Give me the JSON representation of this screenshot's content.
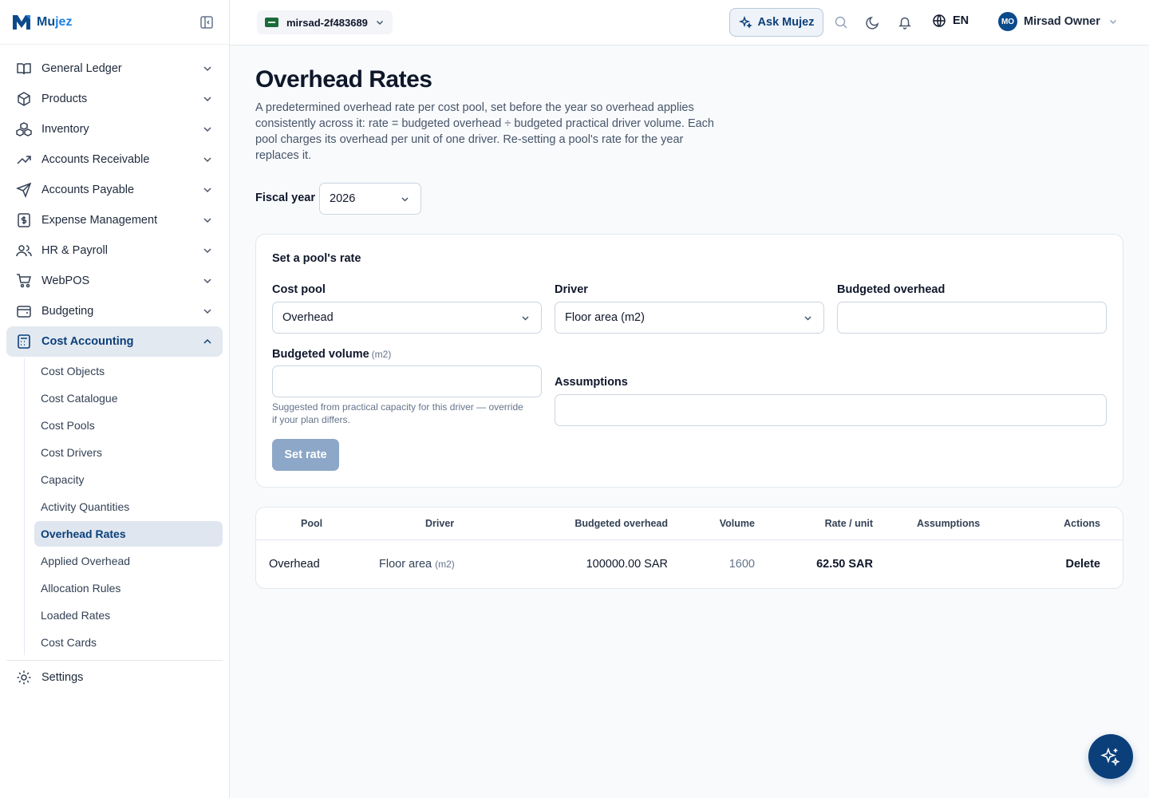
{
  "brand": {
    "name_prefix": "Mu",
    "name_suffix": "jez"
  },
  "org": {
    "name": "mirsad-2f483689"
  },
  "topbar": {
    "ask_label": "Ask Mujez",
    "lang": "EN",
    "user_initials": "MO",
    "user_name": "Mirsad Owner"
  },
  "sidebar": {
    "items": [
      {
        "label": "General Ledger",
        "icon": "book-open-icon"
      },
      {
        "label": "Products",
        "icon": "box-icon"
      },
      {
        "label": "Inventory",
        "icon": "boxes-icon"
      },
      {
        "label": "Accounts Receivable",
        "icon": "trending-up-icon"
      },
      {
        "label": "Accounts Payable",
        "icon": "send-icon"
      },
      {
        "label": "Expense Management",
        "icon": "receipt-icon"
      },
      {
        "label": "HR & Payroll",
        "icon": "users-icon"
      },
      {
        "label": "WebPOS",
        "icon": "cart-icon"
      },
      {
        "label": "Budgeting",
        "icon": "wallet-icon"
      },
      {
        "label": "Cost Accounting",
        "icon": "calculator-icon"
      }
    ],
    "cost_accounting_sub": [
      "Cost Objects",
      "Cost Catalogue",
      "Cost Pools",
      "Cost Drivers",
      "Capacity",
      "Activity Quantities",
      "Overhead Rates",
      "Applied Overhead",
      "Allocation Rules",
      "Loaded Rates",
      "Cost Cards"
    ],
    "settings_label": "Settings"
  },
  "page": {
    "title": "Overhead Rates",
    "description": "A predetermined overhead rate per cost pool, set before the year so overhead applies consistently across it: rate = budgeted overhead ÷ budgeted practical driver volume. Each pool charges its overhead per unit of one driver. Re-setting a pool's rate for the year replaces it.",
    "fiscal_year_label": "Fiscal year",
    "fiscal_year_value": "2026"
  },
  "form": {
    "title": "Set a pool's rate",
    "cost_pool_label": "Cost pool",
    "cost_pool_value": "Overhead",
    "driver_label": "Driver",
    "driver_value": "Floor area (m2)",
    "budgeted_overhead_label": "Budgeted overhead",
    "budgeted_overhead_value": "",
    "budgeted_volume_label": "Budgeted volume",
    "budgeted_volume_unit": "(m2)",
    "budgeted_volume_value": "",
    "hint": "Suggested from practical capacity for this driver — override if your plan differs.",
    "assumptions_label": "Assumptions",
    "assumptions_value": "",
    "submit_label": "Set rate"
  },
  "table": {
    "headers": [
      "Pool",
      "Driver",
      "Budgeted overhead",
      "Volume",
      "Rate / unit",
      "Assumptions",
      "Actions"
    ],
    "rows": [
      {
        "pool": "Overhead",
        "driver": "Floor area",
        "driver_unit": "(m2)",
        "budgeted_overhead": "100000.00 SAR",
        "volume": "1600",
        "rate": "62.50 SAR",
        "assumptions": "",
        "action": "Delete"
      }
    ]
  },
  "colors": {
    "accent": "#0b3f7a",
    "active_bg": "#e3e9f1",
    "button_disabled": "#8ca7c7"
  }
}
